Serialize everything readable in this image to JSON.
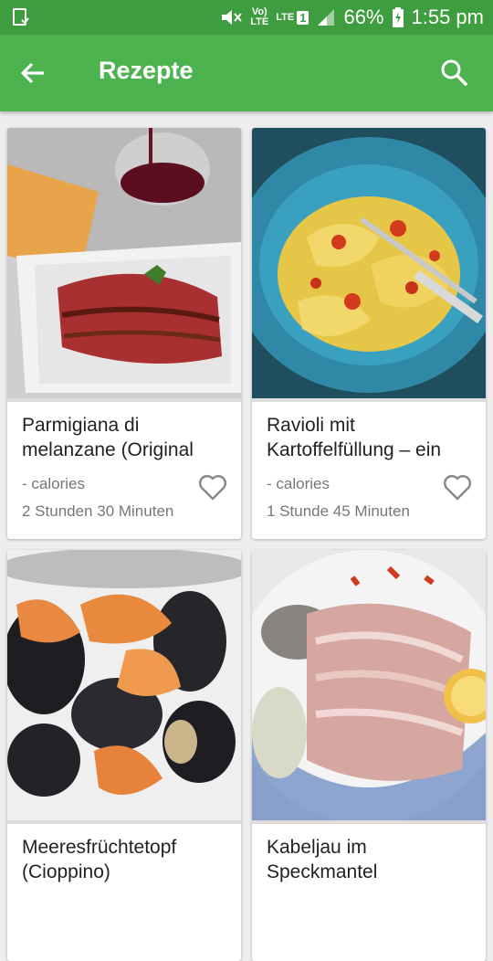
{
  "status_bar": {
    "network_top": "Vo)",
    "network_bottom": "LTE",
    "lte_label": "LTE",
    "sim_slot": "1",
    "battery": "66%",
    "time": "1:55 pm",
    "icons": [
      "sim-manager-icon",
      "mute-icon",
      "volte-icon",
      "lte-icon",
      "signal-icon",
      "battery-icon"
    ]
  },
  "app_bar": {
    "title": "Rezepte",
    "back_icon": "arrow-back-icon",
    "search_icon": "search-icon",
    "color": "#4db34f"
  },
  "recipes": [
    {
      "name": "Parmigiana di melanzane (Original",
      "calories": "- calories",
      "time": "2 Stunden 30 Minuten"
    },
    {
      "name": "Ravioli mit Kartoffelfüllung – ein",
      "calories": "- calories",
      "time": "1 Stunde 45 Minuten"
    },
    {
      "name": "Meeresfrüchtetopf (Cioppino)",
      "calories": "",
      "time": ""
    },
    {
      "name": "Kabeljau im Speckmantel",
      "calories": "",
      "time": ""
    }
  ]
}
